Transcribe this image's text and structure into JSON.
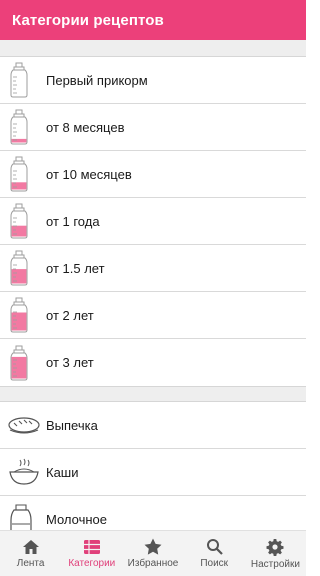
{
  "appbar": {
    "title": "Категории рецептов"
  },
  "age_categories": [
    {
      "label": "Первый прикорм",
      "icon": "baby-bottle-icon",
      "fill": 0.0
    },
    {
      "label": "от 8 месяцев",
      "icon": "baby-bottle-icon",
      "fill": 0.15
    },
    {
      "label": "от 10 месяцев",
      "icon": "baby-bottle-icon",
      "fill": 0.3
    },
    {
      "label": "от 1 года",
      "icon": "baby-bottle-icon",
      "fill": 0.45
    },
    {
      "label": "от 1.5 лет",
      "icon": "baby-bottle-icon",
      "fill": 0.6
    },
    {
      "label": "от 2 лет",
      "icon": "baby-bottle-icon",
      "fill": 0.75
    },
    {
      "label": "от 3 лет",
      "icon": "baby-bottle-icon",
      "fill": 0.9
    }
  ],
  "food_categories": [
    {
      "label": "Выпечка",
      "icon": "bread-icon"
    },
    {
      "label": "Каши",
      "icon": "porridge-bowl-icon"
    },
    {
      "label": "Молочное",
      "icon": "milk-jug-icon"
    }
  ],
  "tabs": [
    {
      "label": "Лента",
      "icon": "home-icon",
      "active": false
    },
    {
      "label": "Категории",
      "icon": "list-icon",
      "active": true
    },
    {
      "label": "Избранное",
      "icon": "star-icon",
      "active": false
    },
    {
      "label": "Поиск",
      "icon": "search-icon",
      "active": false
    },
    {
      "label": "Настройки",
      "icon": "gear-icon",
      "active": false
    }
  ],
  "colors": {
    "accent": "#ec407a",
    "bottle_fill": "#f06292",
    "tab_active": "#e0407a"
  }
}
